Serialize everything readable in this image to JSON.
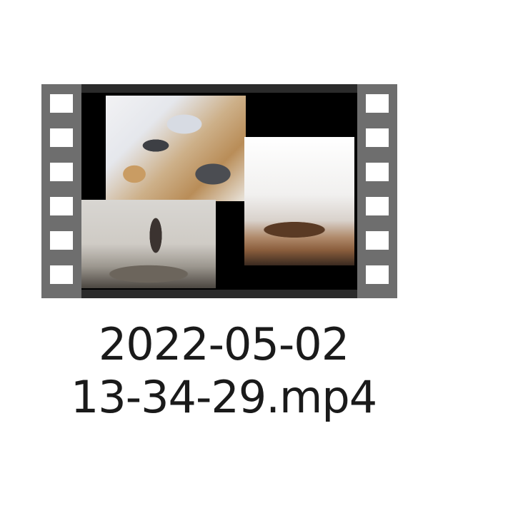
{
  "file": {
    "icon": "video-file-icon",
    "name_line1": "2022-05-02",
    "name_line2": "13-34-29.mp4"
  }
}
